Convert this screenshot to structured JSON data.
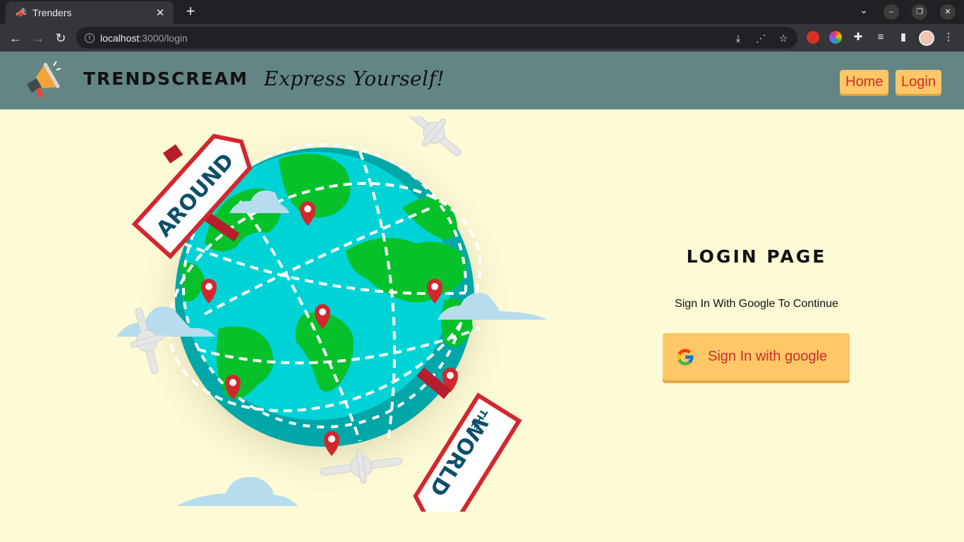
{
  "browser": {
    "tab_title": "Trenders",
    "tab_favicon": "megaphone-icon",
    "url_host": "localhost",
    "url_rest": ":3000/login"
  },
  "navbar": {
    "brand_name": "TRENDSCREAM",
    "tagline": "Express Yourself!",
    "links": [
      "Home",
      "Login"
    ]
  },
  "illustration": {
    "sign_top": "AROUND",
    "sign_bottom_small": "THE",
    "sign_bottom_large": "WORLD"
  },
  "login": {
    "title": "LOGIN PAGE",
    "subtitle": "Sign In With Google To Continue",
    "button_label": "Sign In with google",
    "button_icon": "google-icon"
  },
  "colors": {
    "navbar_bg": "#638685",
    "page_bg": "#fdfad6",
    "button_bg": "#ffc766",
    "button_text": "#c9302c"
  }
}
